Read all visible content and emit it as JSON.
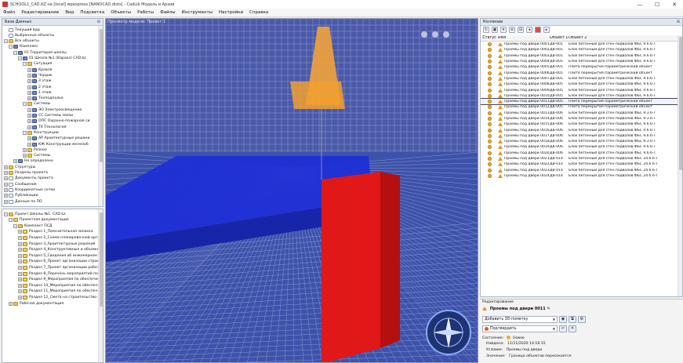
{
  "window": {
    "title": "SCHOOL1_CAD.KZ на [local] wpexpress [NANOCAD.dists] - CadLib Модель и Архив",
    "controls": [
      "—",
      "☐",
      "✕"
    ]
  },
  "menu": [
    "Файл",
    "Редактирование",
    "Вид",
    "Подсветка",
    "Объекты",
    "Работы",
    "Файлы",
    "Инструменты",
    "Настройки",
    "Справка"
  ],
  "db_panel": {
    "title": "База Данных",
    "tree": [
      {
        "label": "Текущий вид",
        "icon": "doc",
        "depth": 0,
        "exp": ""
      },
      {
        "label": "Выбранные объекты",
        "icon": "doc",
        "depth": 0,
        "exp": ""
      },
      {
        "label": "Все объекты",
        "icon": "folder",
        "depth": 0,
        "exp": "−"
      },
      {
        "label": "Комплекс",
        "icon": "node",
        "depth": 1,
        "exp": "−"
      },
      {
        "label": "01 Территория школы",
        "icon": "node",
        "depth": 2,
        "exp": "−"
      },
      {
        "label": "01 Школа №1 (Караоз) CAD.kz",
        "icon": "node",
        "depth": 3,
        "exp": "−"
      },
      {
        "label": "Ситуация",
        "icon": "folder",
        "depth": 4,
        "exp": "−"
      },
      {
        "label": "Кровля",
        "icon": "node",
        "depth": 5,
        "exp": "+"
      },
      {
        "label": "Чердак",
        "icon": "node",
        "depth": 5,
        "exp": "+"
      },
      {
        "label": "3 этаж",
        "icon": "node",
        "depth": 5,
        "exp": "+"
      },
      {
        "label": "2 этаж",
        "icon": "node",
        "depth": 5,
        "exp": "+"
      },
      {
        "label": "1 этаж",
        "icon": "node",
        "depth": 5,
        "exp": "+"
      },
      {
        "label": "Техподполье",
        "icon": "node",
        "depth": 5,
        "exp": "+"
      },
      {
        "label": "Системы",
        "icon": "folder",
        "depth": 4,
        "exp": "−"
      },
      {
        "label": "ЭО Электроосвещение",
        "icon": "node",
        "depth": 5,
        "exp": "+"
      },
      {
        "label": "СС Системы связи",
        "icon": "node",
        "depth": 5,
        "exp": "+"
      },
      {
        "label": "ОПС Охранно-пожарная си",
        "icon": "node",
        "depth": 5,
        "exp": "+"
      },
      {
        "label": "ТХ Технология",
        "icon": "node",
        "depth": 5,
        "exp": "+"
      },
      {
        "label": "Конструкции",
        "icon": "folder",
        "depth": 4,
        "exp": "−"
      },
      {
        "label": "АР Архитектурные решени",
        "icon": "node",
        "depth": 5,
        "exp": "+"
      },
      {
        "label": "КЖ Конструкции железоб",
        "icon": "node",
        "depth": 5,
        "exp": "+"
      },
      {
        "label": "Разное",
        "icon": "folder",
        "depth": 4,
        "exp": "+"
      },
      {
        "label": "Системы",
        "icon": "folder",
        "depth": 4,
        "exp": "+"
      },
      {
        "label": "Не определено",
        "icon": "node",
        "depth": 2,
        "exp": "+"
      },
      {
        "label": "Структуры",
        "icon": "folder",
        "depth": 0,
        "exp": "+"
      },
      {
        "label": "Разделы проекта",
        "icon": "folder",
        "depth": 0,
        "exp": "+"
      },
      {
        "label": "Документы проекта",
        "icon": "doc",
        "depth": 0,
        "exp": "+"
      },
      {
        "label": "Сообщения",
        "icon": "doc",
        "depth": 0,
        "exp": "+"
      },
      {
        "label": "Координатные сетки",
        "icon": "doc",
        "depth": 0,
        "exp": "+"
      },
      {
        "label": "Публикации",
        "icon": "doc",
        "depth": 0,
        "exp": "+"
      },
      {
        "label": "Данные по ПО",
        "icon": "doc",
        "depth": 0,
        "exp": "+"
      }
    ]
  },
  "project_panel": {
    "tree": [
      {
        "label": "Проект Школы №1. CAD.kz",
        "icon": "folder",
        "depth": 0,
        "exp": "−"
      },
      {
        "label": "Проектная документация",
        "icon": "folder",
        "depth": 1,
        "exp": "−"
      },
      {
        "label": "Комплект ПСД",
        "icon": "folder",
        "depth": 2,
        "exp": "−"
      },
      {
        "label": "Раздел 1_Пояснительная записка",
        "icon": "task",
        "depth": 3,
        "exp": "+"
      },
      {
        "label": "Раздел 2_Схема планировочной орга",
        "icon": "task",
        "depth": 3,
        "exp": "+"
      },
      {
        "label": "Раздел 3_Архитектурные решения",
        "icon": "task",
        "depth": 3,
        "exp": "+"
      },
      {
        "label": "Раздел 4_Конструктивные и объемн",
        "icon": "task",
        "depth": 3,
        "exp": "+"
      },
      {
        "label": "Раздел 5_Сведения об инженерном о",
        "icon": "task",
        "depth": 3,
        "exp": "+"
      },
      {
        "label": "Раздел 6_Проект организации строит",
        "icon": "task",
        "depth": 3,
        "exp": "+"
      },
      {
        "label": "Раздел 7_Проект организации работ",
        "icon": "task",
        "depth": 3,
        "exp": "+"
      },
      {
        "label": "Раздел 8_Перечень мероприятий по о",
        "icon": "task",
        "depth": 3,
        "exp": "+"
      },
      {
        "label": "Раздел 9_Мероприятия по обеспечен",
        "icon": "task",
        "depth": 3,
        "exp": "+"
      },
      {
        "label": "Раздел 10_Мероприятия по обеспече",
        "icon": "task",
        "depth": 3,
        "exp": "+"
      },
      {
        "label": "Раздел 11_Мероприятия по обеспече",
        "icon": "task",
        "depth": 3,
        "exp": "+"
      },
      {
        "label": "Раздел 12_Смета на строительство о",
        "icon": "task",
        "depth": 3,
        "exp": "+"
      },
      {
        "label": "Рабочая документация",
        "icon": "folder",
        "depth": 1,
        "exp": "+"
      }
    ]
  },
  "viewport": {
    "title": "Просмотр модели: Проект 1"
  },
  "collisions": {
    "title": "Коллизии",
    "headers": [
      "Статус",
      "Имя",
      "Объект 1",
      "Объект 2"
    ],
    "selected_index": 10,
    "rows": [
      {
        "name": "Проемы под двери 0001",
        "o1": "ДВ-001",
        "o2": "Блок бетонный для стен подвалов ФБС 9.6.6-Т"
      },
      {
        "name": "Проемы под двери 0002",
        "o1": "ДВ-001",
        "o2": "Блок бетонный для стен подвалов ФБС 9.6.6-Т"
      },
      {
        "name": "Проемы под двери 0003",
        "o1": "ДВ-001",
        "o2": "Блок бетонный для стен подвалов ФБС 9.6.6-Т"
      },
      {
        "name": "Проемы под двери 0004",
        "o1": "ДВ-001",
        "o2": "Блок бетонный для стен подвалов ФБС 9.6.6-Т"
      },
      {
        "name": "Проемы под двери 0005",
        "o1": "ДВ-001",
        "o2": "Плита перекрытия параметрический объект"
      },
      {
        "name": "Проемы под двери 0006",
        "o1": "ДВ-001",
        "o2": "Плита перекрытия параметрический объект"
      },
      {
        "name": "Проемы под двери 0007",
        "o1": "ДВ-001",
        "o2": "Блок бетонный для стен подвалов ФБС 9.6.6-Т"
      },
      {
        "name": "Проемы под двери 0008",
        "o1": "ДВ-005",
        "o2": "Блок бетонный для стен подвалов ФБС 9.6.6-Т"
      },
      {
        "name": "Проемы под двери 0009",
        "o1": "ДВ-005",
        "o2": "Блок бетонный для стен подвалов ФБС 9.6.6-Т"
      },
      {
        "name": "Проемы под двери 0010",
        "o1": "ДВ-005",
        "o2": "Блок бетонный для стен подвалов ФБС 9.6.6-Т"
      },
      {
        "name": "Проемы под двери 0011",
        "o1": "ДВ-005",
        "o2": "Плита перекрытия параметрический объект"
      },
      {
        "name": "Проемы под двери 0012",
        "o1": "ДВ-005",
        "o2": "Плита перекрытия параметрический объект"
      },
      {
        "name": "Проемы под двери 0013",
        "o1": "ДВ-006",
        "o2": "Блок бетонный для стен подвалов ФБС 9.3.6-Т"
      },
      {
        "name": "Проемы под двери 0014",
        "o1": "ДВ-006",
        "o2": "Блок бетонный для стен подвалов ФБС 9.3.6-Т"
      },
      {
        "name": "Проемы под двери 0015",
        "o1": "ДВ-006",
        "o2": "Блок бетонный для стен подвалов ФБС 9.6.6-Т"
      },
      {
        "name": "Проемы под двери 0016",
        "o1": "ДВ-006",
        "o2": "Блок бетонный для стен подвалов ФБС 9.6.6-Т"
      },
      {
        "name": "Проемы под двери 0017",
        "o1": "ДВ-006",
        "o2": "Блок бетонный для стен подвалов ФБС 9.6.6-Т"
      },
      {
        "name": "Проемы под двери 0018",
        "o1": "ДВ-006",
        "o2": "Блок бетонный для стен подвалов ФБС 9.3.6-Т"
      },
      {
        "name": "Проемы под двери 0019",
        "o1": "ДВ-006",
        "o2": "Блок бетонный для стен подвалов ФБС 9.6.6-Т"
      },
      {
        "name": "Проемы под двери 0020",
        "o1": "ДВ-006",
        "o2": "Блок бетонный для стен подвалов ФБС 9.6.6-Т"
      },
      {
        "name": "Проемы под двери 0021",
        "o1": "ДВ-014",
        "o2": "Блок бетонный для стен подвалов ФБС 24.6.6-Т"
      },
      {
        "name": "Проемы под двери 0022",
        "o1": "ДВ-014",
        "o2": "Блок бетонный для стен подвалов ФБС 24.6.6-Т"
      },
      {
        "name": "Проемы под двери 0023",
        "o1": "ДВ-014",
        "o2": "Блок бетонный для стен подвалов ФБС 24.6.6-Т"
      },
      {
        "name": "Проемы под двери 0024",
        "o1": "ДВ-014",
        "o2": "Блок бетонный для стен подвалов ФБС 24.6.6-Т"
      }
    ]
  },
  "editing": {
    "title": "Редактирование",
    "item_name": "Проемы под двери 0011",
    "add_point_label": "Добавить 3D-пометку",
    "status_action": "Подтвердить",
    "state_label": "Состояние:",
    "state_value": "Новое",
    "found_label": "Найдена:",
    "found_value": "11/11/2020 14:16:15",
    "condition_label": "Условие:",
    "condition_value": "Проемы под двери",
    "meaning_label": "Значение:",
    "meaning_value": "Граница объектов пересекается"
  },
  "colors": {
    "viewport_bg": "#3b4ea8",
    "highlight_red": "#e01818",
    "highlight_orange": "#f2a23a",
    "highlight_blue": "#1a2fd0"
  }
}
